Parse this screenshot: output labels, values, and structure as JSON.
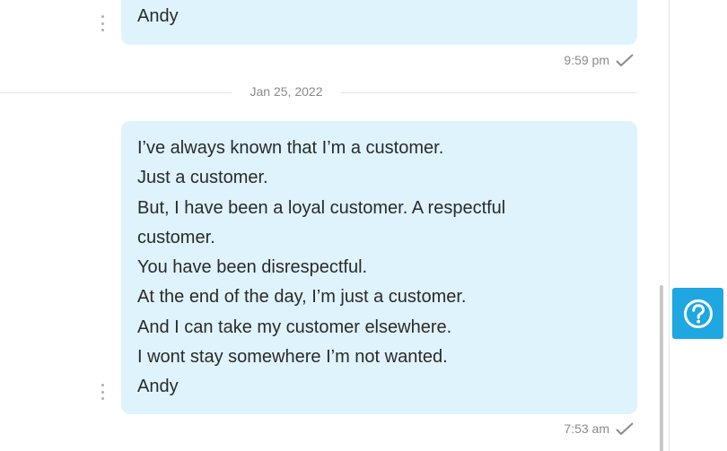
{
  "conversation": {
    "messages": [
      {
        "lines": [
          "Andy"
        ],
        "time": "9:59 pm",
        "status_icon": "check-icon"
      },
      {
        "lines": [
          "I’ve always known that I’m a customer.",
          "Just a customer.",
          "But, I have been a loyal customer. A respectful",
          "customer.",
          "You have been disrespectful.",
          "At the end of the day, I’m just a customer.",
          "And I can take my customer elsewhere.",
          "I wont stay somewhere I’m not wanted.",
          "Andy"
        ],
        "time": "7:53 am",
        "status_icon": "check-icon"
      }
    ],
    "date_separator": "Jan 25, 2022"
  },
  "help_button": {
    "icon": "help-question-icon"
  },
  "colors": {
    "bubble_bg": "#dff3fd",
    "accent": "#1ea7e1",
    "meta_text": "#8a8a8a"
  }
}
